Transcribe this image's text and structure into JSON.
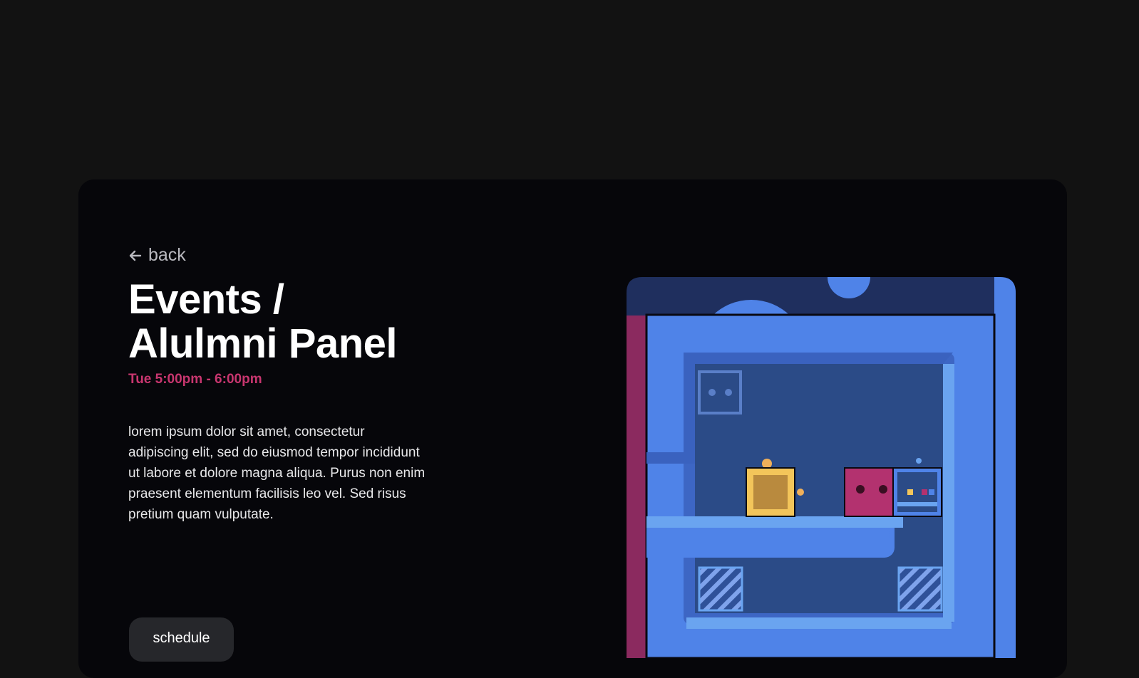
{
  "back": {
    "label": "back",
    "icon": "arrow-left-icon"
  },
  "event": {
    "title_line1": "Events /",
    "title_line2": "Alulmni Panel",
    "time": "Tue 5:00pm - 6:00pm",
    "description": "lorem ipsum dolor sit amet, consectetur adipiscing elit, sed do eiusmod tempor incididunt ut labore et dolore magna aliqua. Purus non enim praesent elementum facilisis leo vel. Sed risus pretium quam vulputate."
  },
  "schedule_button": {
    "label": "schedule"
  },
  "colors": {
    "page_bg": "#121212",
    "card_bg": "#06060a",
    "accent_time": "#c8366f",
    "game_blue": "#4f83e8",
    "game_dark": "#2b4b87",
    "game_pink": "#b3326f",
    "game_yellow": "#f3c55a"
  }
}
